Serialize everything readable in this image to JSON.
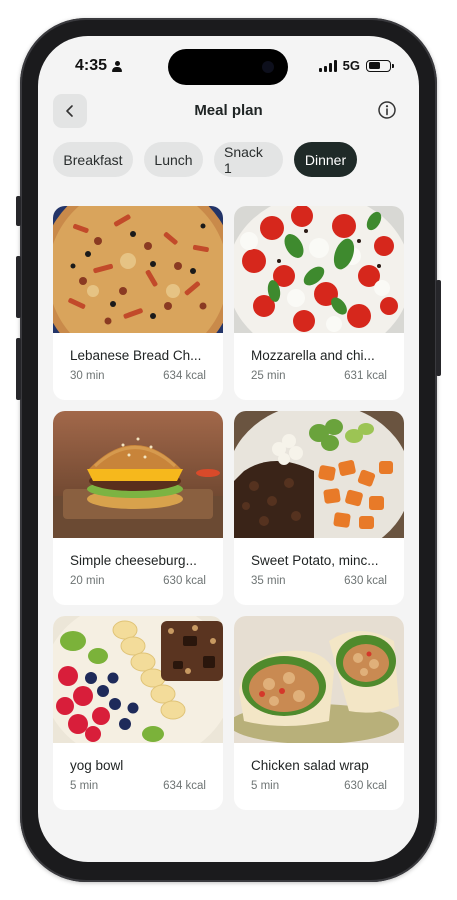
{
  "status_bar": {
    "time": "4:35",
    "network": "5G"
  },
  "header": {
    "title": "Meal plan"
  },
  "tabs": [
    {
      "label": "Breakfast",
      "active": false
    },
    {
      "label": "Lunch",
      "active": false
    },
    {
      "label": "Snack 1",
      "active": false
    },
    {
      "label": "Dinner",
      "active": true
    }
  ],
  "meals": [
    {
      "title": "Lebanese Bread Ch...",
      "time": "30 min",
      "kcal": "634 kcal",
      "image": "pizza-photo"
    },
    {
      "title": "Mozzarella and chi...",
      "time": "25 min",
      "kcal": "631 kcal",
      "image": "caprese-salad-photo"
    },
    {
      "title": "Simple cheeseburg...",
      "time": "20 min",
      "kcal": "630 kcal",
      "image": "cheeseburger-photo"
    },
    {
      "title": "Sweet Potato, minc...",
      "time": "35 min",
      "kcal": "630 kcal",
      "image": "sweet-potato-bowl-photo"
    },
    {
      "title": "yog bowl",
      "time": "5 min",
      "kcal": "634 kcal",
      "image": "yogurt-bowl-photo"
    },
    {
      "title": "Chicken salad wrap",
      "time": "5 min",
      "kcal": "630 kcal",
      "image": "chicken-wrap-photo"
    }
  ],
  "colors": {
    "active_tab": "#1f2a28",
    "tab_bg": "#e3e4e4",
    "screen_bg": "#f4f4f4"
  }
}
